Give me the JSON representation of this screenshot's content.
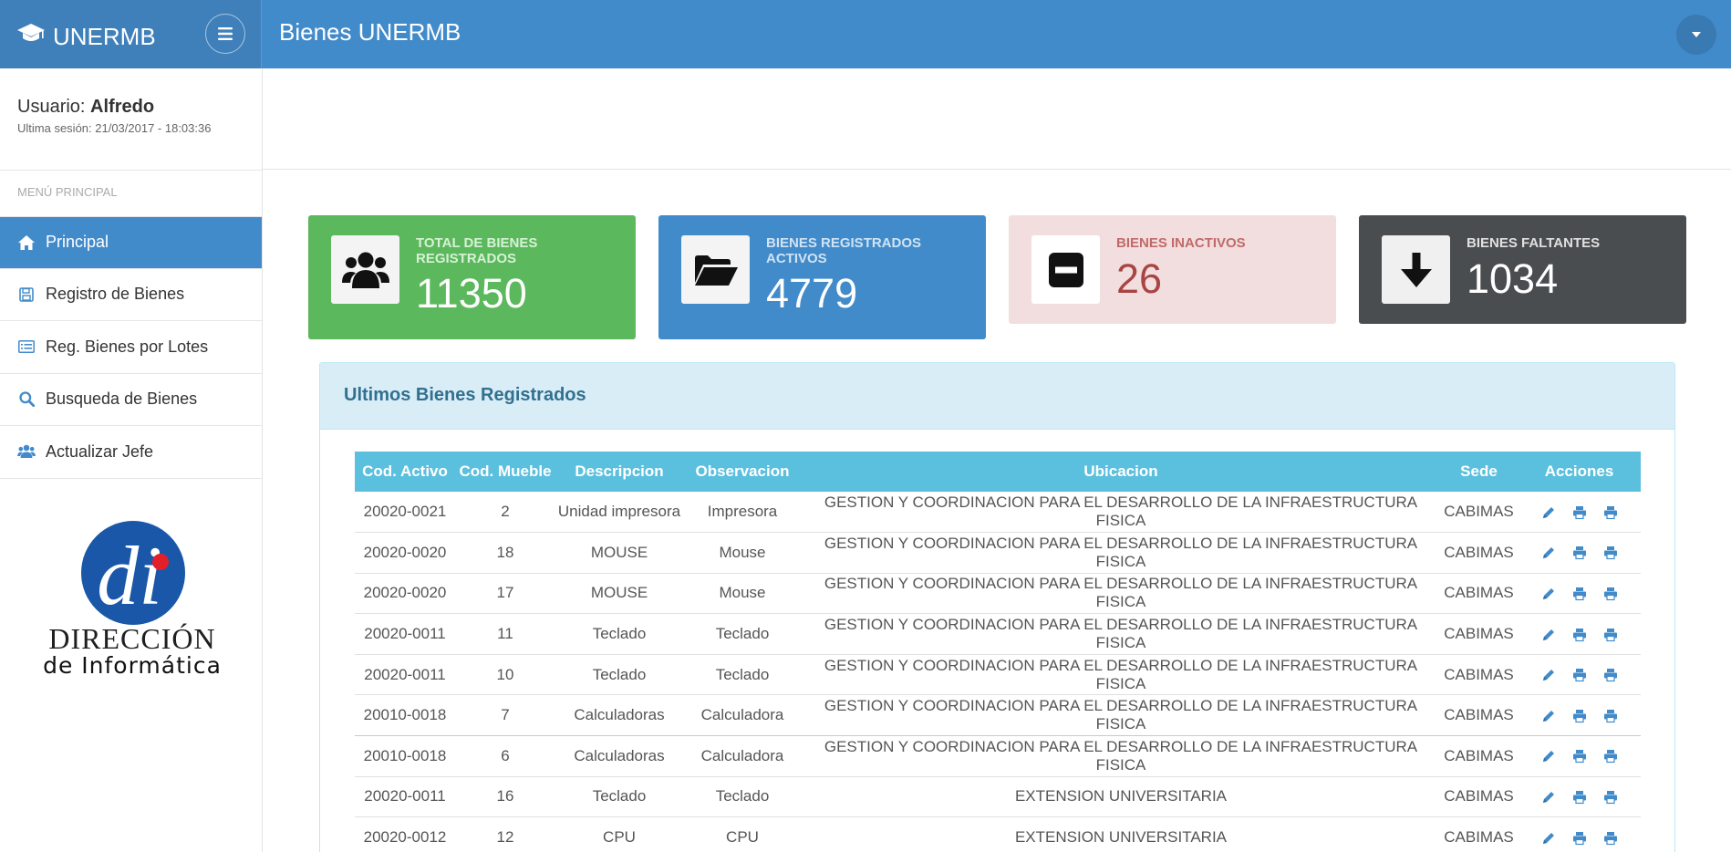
{
  "app": {
    "brand": "UNERMB",
    "page_heading": "Bienes UNERMB"
  },
  "sidebar": {
    "user_label": "Usuario:",
    "user_name": "Alfredo",
    "last_session": "Ultima sesión: 21/03/2017 - 18:03:36",
    "menu_title": "MENÚ PRINCIPAL",
    "items": [
      {
        "label": "Principal",
        "icon": "home-icon"
      },
      {
        "label": "Registro de Bienes",
        "icon": "floppy-icon"
      },
      {
        "label": "Reg. Bienes por Lotes",
        "icon": "list-icon"
      },
      {
        "label": "Busqueda de Bienes",
        "icon": "search-icon"
      },
      {
        "label": "Actualizar Jefe",
        "icon": "users-icon"
      }
    ],
    "logo": {
      "line1": "DIRECCIÓN",
      "line2": "de Informática"
    }
  },
  "stats": {
    "total": {
      "label": "TOTAL DE BIENES REGISTRADOS",
      "value": "11350"
    },
    "active": {
      "label": "BIENES REGISTRADOS ACTIVOS",
      "value": "4779"
    },
    "inactive": {
      "label": "BIENES INACTIVOS",
      "value": "26"
    },
    "missing": {
      "label": "BIENES FALTANTES",
      "value": "1034"
    }
  },
  "panel": {
    "title": "Ultimos Bienes Registrados",
    "columns": [
      "Cod. Activo",
      "Cod. Mueble",
      "Descripcion",
      "Observacion",
      "Ubicacion",
      "Sede",
      "Acciones"
    ],
    "rows": [
      [
        "20020-0021",
        "2",
        "Unidad impresora",
        "Impresora",
        "GESTION Y COORDINACION PARA EL DESARROLLO DE LA INFRAESTRUCTURA FISICA",
        "CABIMAS"
      ],
      [
        "20020-0020",
        "18",
        "MOUSE",
        "Mouse",
        "GESTION Y COORDINACION PARA EL DESARROLLO DE LA INFRAESTRUCTURA FISICA",
        "CABIMAS"
      ],
      [
        "20020-0020",
        "17",
        "MOUSE",
        "Mouse",
        "GESTION Y COORDINACION PARA EL DESARROLLO DE LA INFRAESTRUCTURA FISICA",
        "CABIMAS"
      ],
      [
        "20020-0011",
        "11",
        "Teclado",
        "Teclado",
        "GESTION Y COORDINACION PARA EL DESARROLLO DE LA INFRAESTRUCTURA FISICA",
        "CABIMAS"
      ],
      [
        "20020-0011",
        "10",
        "Teclado",
        "Teclado",
        "GESTION Y COORDINACION PARA EL DESARROLLO DE LA INFRAESTRUCTURA FISICA",
        "CABIMAS"
      ],
      [
        "20010-0018",
        "7",
        "Calculadoras",
        "Calculadora",
        "GESTION Y COORDINACION PARA EL DESARROLLO DE LA INFRAESTRUCTURA FISICA",
        "CABIMAS"
      ],
      [
        "20010-0018",
        "6",
        "Calculadoras",
        "Calculadora",
        "GESTION Y COORDINACION PARA EL DESARROLLO DE LA INFRAESTRUCTURA FISICA",
        "CABIMAS"
      ],
      [
        "20020-0011",
        "16",
        "Teclado",
        "Teclado",
        "EXTENSION UNIVERSITARIA",
        "CABIMAS"
      ],
      [
        "20020-0012",
        "12",
        "CPU",
        "CPU",
        "EXTENSION UNIVERSITARIA",
        "CABIMAS"
      ]
    ],
    "action_icons": [
      "edit-icon",
      "print-icon",
      "print-icon"
    ]
  },
  "colors": {
    "primary": "#428bca",
    "success": "#5cb85c",
    "danger_bg": "#f2dede",
    "dark": "#4a4d50",
    "info": "#5bc0de"
  }
}
